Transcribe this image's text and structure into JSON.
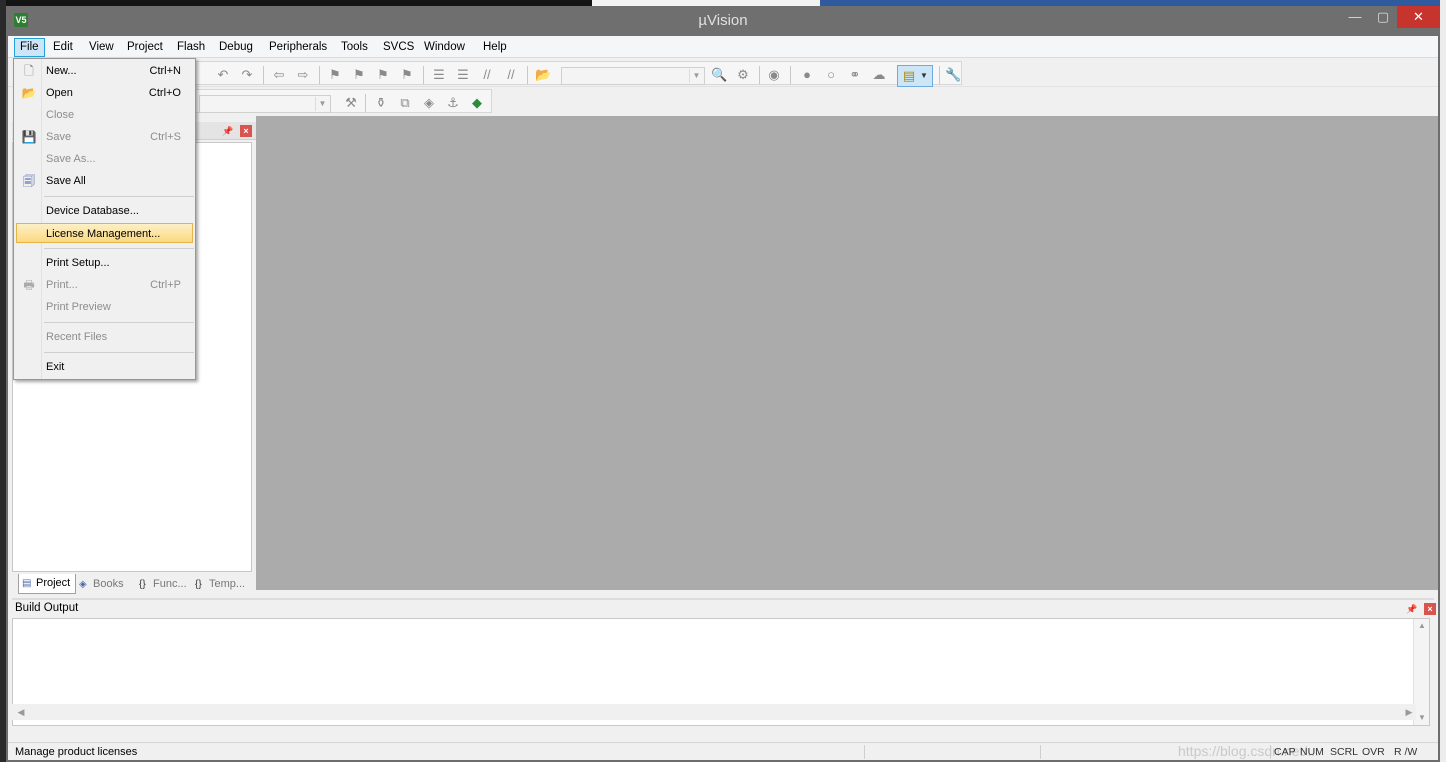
{
  "window": {
    "title": "µVision",
    "app_icon_text": "V5",
    "min_glyph": "—",
    "max_glyph": "▢",
    "close_glyph": "✕"
  },
  "menubar": {
    "items": [
      "File",
      "Edit",
      "View",
      "Project",
      "Flash",
      "Debug",
      "Peripherals",
      "Tools",
      "SVCS",
      "Window",
      "Help"
    ],
    "open_item": "File"
  },
  "file_menu": {
    "items": [
      {
        "label": "New...",
        "shortcut": "Ctrl+N",
        "icon": "new-file-icon",
        "enabled": true
      },
      {
        "label": "Open",
        "shortcut": "Ctrl+O",
        "icon": "open-folder-icon",
        "enabled": true
      },
      {
        "label": "Close",
        "shortcut": "",
        "icon": "",
        "enabled": false
      },
      {
        "label": "Save",
        "shortcut": "Ctrl+S",
        "icon": "save-icon",
        "enabled": false
      },
      {
        "label": "Save As...",
        "shortcut": "",
        "icon": "",
        "enabled": false
      },
      {
        "label": "Save All",
        "shortcut": "",
        "icon": "save-all-icon",
        "enabled": true
      },
      {
        "label": "Device Database...",
        "shortcut": "",
        "icon": "",
        "enabled": true
      },
      {
        "label": "License Management...",
        "shortcut": "",
        "icon": "",
        "enabled": true,
        "highlighted": true
      },
      {
        "label": "Print Setup...",
        "shortcut": "",
        "icon": "",
        "enabled": true
      },
      {
        "label": "Print...",
        "shortcut": "Ctrl+P",
        "icon": "print-icon",
        "enabled": false
      },
      {
        "label": "Print Preview",
        "shortcut": "",
        "icon": "",
        "enabled": false
      },
      {
        "label": "Recent Files",
        "shortcut": "",
        "icon": "",
        "enabled": false
      },
      {
        "label": "Exit",
        "shortcut": "",
        "icon": "",
        "enabled": true
      }
    ]
  },
  "project_panel": {
    "tabs": [
      {
        "label": "Project",
        "icon": "project-icon",
        "active": true
      },
      {
        "label": "Books",
        "icon": "books-icon",
        "active": false
      },
      {
        "label": "Func...",
        "icon": "functions-icon",
        "active": false
      },
      {
        "label": "Temp...",
        "icon": "templates-icon",
        "active": false
      }
    ]
  },
  "build_output": {
    "title": "Build Output"
  },
  "statusbar": {
    "message": "Manage product licenses",
    "flags": [
      "CAP",
      "NUM",
      "SCRL",
      "OVR",
      "R /W"
    ],
    "watermark": "https://blog.csdn.net/..."
  },
  "colors": {
    "title_bar": "#6f6f6f",
    "close_button": "#c7332d",
    "editor_background": "#ababab",
    "menu_highlight": "#fbd97f",
    "menu_open": "#cde6f7"
  }
}
